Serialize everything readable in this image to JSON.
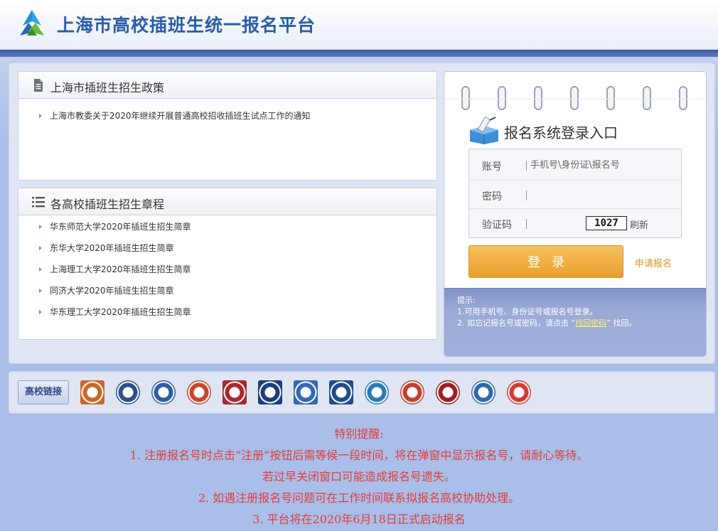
{
  "header": {
    "site_title": "上海市高校插班生统一报名平台",
    "logo_icon": "mountain-logo-icon"
  },
  "policy_panel": {
    "title": "上海市插班生招生政策",
    "icon": "document-icon",
    "items": [
      {
        "label": "上海市教委关于2020年继续开展普通高校招收插班生试点工作的通知"
      }
    ]
  },
  "rules_panel": {
    "title": "各高校插班生招生章程",
    "icon": "list-icon",
    "items": [
      {
        "label": "华东师范大学2020年插班生招生简章"
      },
      {
        "label": "东华大学2020年插班生招生简章"
      },
      {
        "label": "上海理工大学2020年插班生招生简章"
      },
      {
        "label": "同济大学2020年插班生招生简章"
      },
      {
        "label": "华东理工大学2020年插班生招生简章"
      }
    ]
  },
  "login": {
    "title": "报名系统登录入口",
    "account_label": "账号",
    "account_placeholder": "手机号\\身份证\\报名号",
    "password_label": "密码",
    "captcha_label": "验证码",
    "captcha_code": "1027",
    "refresh_label": "刷新",
    "login_button": "登录",
    "apply_link": "申请报名",
    "tips_title": "提示:",
    "tip1": "1.可用手机号、身份证号或报名号登录。",
    "tip2_prefix": "2. 如忘记报名号或密码，请点击 “",
    "tip2_link": "找回密码",
    "tip2_suffix": "” 找回。"
  },
  "links_bar": {
    "label": "高校链接",
    "logos": [
      {
        "name": "univ-logo-1-icon",
        "color": "#c9682a"
      },
      {
        "name": "univ-logo-2-icon",
        "color": "#2b4f8a"
      },
      {
        "name": "univ-logo-3-icon",
        "color": "#2f5fa0"
      },
      {
        "name": "univ-logo-4-icon",
        "color": "#c6482c"
      },
      {
        "name": "univ-logo-5-icon",
        "color": "#a8282c"
      },
      {
        "name": "univ-logo-6-icon",
        "color": "#1d3e7a"
      },
      {
        "name": "univ-logo-7-icon",
        "color": "#3568b0"
      },
      {
        "name": "univ-logo-8-icon",
        "color": "#1f4b8c"
      },
      {
        "name": "univ-logo-9-icon",
        "color": "#2a78b8"
      },
      {
        "name": "univ-logo-10-icon",
        "color": "#c4412b"
      },
      {
        "name": "univ-logo-11-icon",
        "color": "#9c1f26"
      },
      {
        "name": "univ-logo-12-icon",
        "color": "#2f6aa8"
      },
      {
        "name": "univ-logo-13-icon",
        "color": "#d43b36"
      }
    ]
  },
  "notice": {
    "title": "特别提醒:",
    "line1": "1. 注册报名号时点击“注册”按钮后需等候一段时间，将在弹窗中显示报名号，请耐心等待。",
    "line2": "若过早关闭窗口可能造成报名号遗失。",
    "line3": "2. 如遇注册报名号问题可在工作时间联系拟报名高校协助处理。",
    "line4": "3. 平台将在2020年6月18日正式启动报名"
  },
  "colors": {
    "accent_blue": "#2a5da8",
    "login_button": "#f0b246",
    "notice_red": "#e23c3c",
    "page_bg": "#a9bfe9"
  }
}
